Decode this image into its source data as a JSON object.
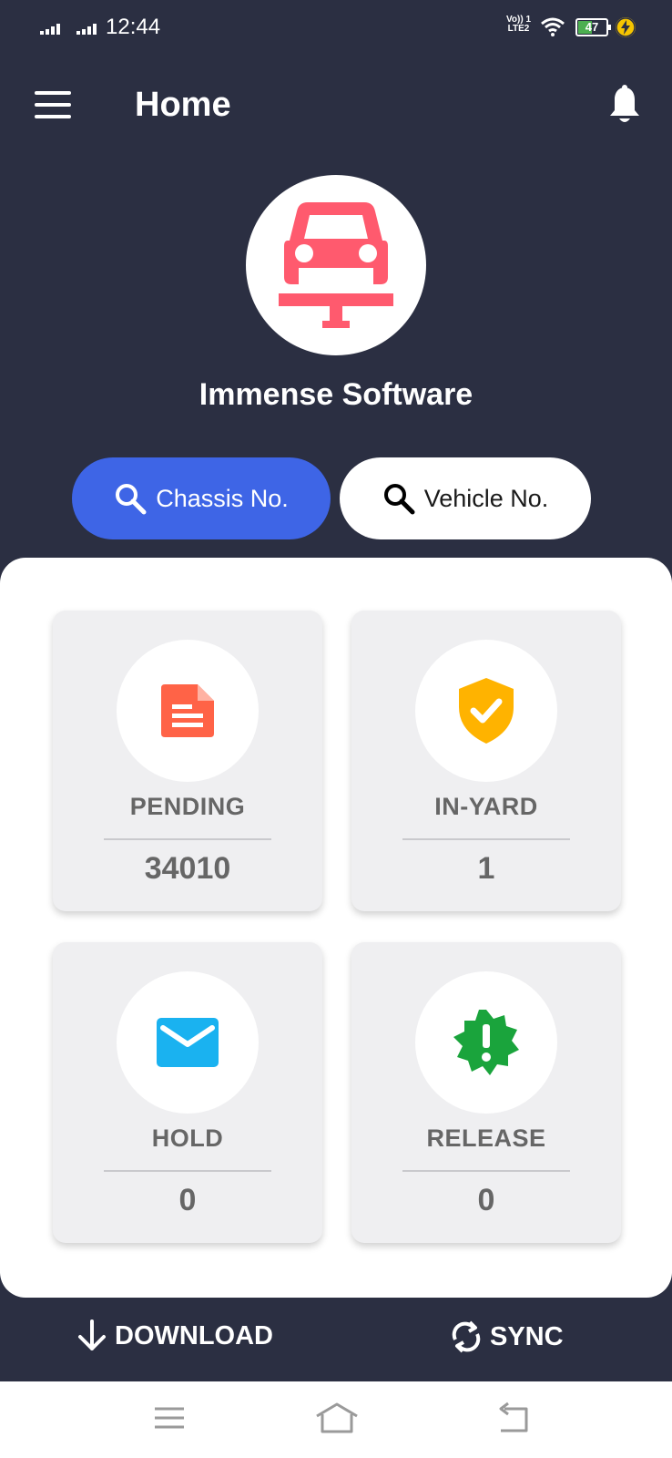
{
  "status_bar": {
    "time": "12:44",
    "network_label_top": "Vo)) 1",
    "network_label_bottom": "LTE2",
    "battery": "47"
  },
  "header": {
    "title": "Home"
  },
  "company": {
    "name": "Immense Software"
  },
  "search": {
    "chassis_label": "Chassis No.",
    "vehicle_label": "Vehicle No."
  },
  "cards": [
    {
      "label": "PENDING",
      "count": "34010",
      "icon": "document-icon",
      "color": "#ff6347"
    },
    {
      "label": "IN-YARD",
      "count": "1",
      "icon": "shield-check-icon",
      "color": "#ffb300"
    },
    {
      "label": "HOLD",
      "count": "0",
      "icon": "mail-icon",
      "color": "#1ab2f0"
    },
    {
      "label": "RELEASE",
      "count": "0",
      "icon": "alert-badge-icon",
      "color": "#1aa43c"
    }
  ],
  "actions": {
    "download_label": "DOWNLOAD",
    "sync_label": "SYNC"
  },
  "colors": {
    "background": "#2b2f42",
    "accent": "#3e65e6",
    "logo": "#ff5a6e"
  }
}
